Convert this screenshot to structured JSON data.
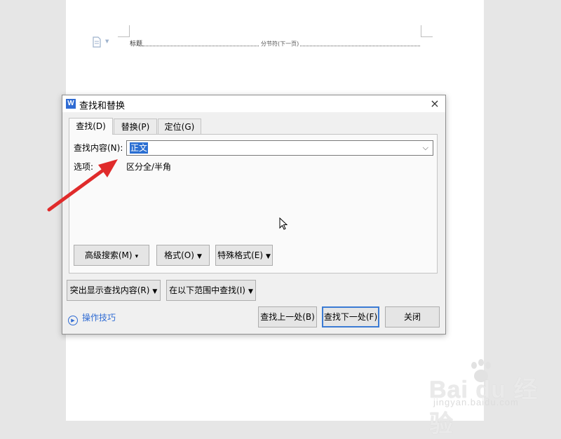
{
  "document": {
    "heading_text": "标题",
    "section_break_label": "分节符(下一页)"
  },
  "dialog": {
    "title": "查找和替换",
    "app_icon_letter": "W",
    "close_glyph": "×",
    "tabs": [
      {
        "label": "查找(D)",
        "active": true
      },
      {
        "label": "替换(P)",
        "active": false
      },
      {
        "label": "定位(G)",
        "active": false
      }
    ],
    "find": {
      "label": "查找内容(N):",
      "value": "正文",
      "dropdown_glyph": "⌵"
    },
    "options": {
      "label": "选项:",
      "value": "区分全/半角"
    },
    "buttons": {
      "advanced_search": "高级搜索(M)",
      "format": "格式(O)",
      "special_format": "特殊格式(E)",
      "highlight": "突出显示查找内容(R)",
      "find_in": "在以下范围中查找(I)",
      "find_prev": "查找上一处(B)",
      "find_next": "查找下一处(F)",
      "close": "关闭"
    },
    "tips_label": "操作技巧"
  },
  "watermark": {
    "brand": "Bai du 经验",
    "url": "jingyan.baidu.com"
  },
  "colors": {
    "accent": "#2f6bd3",
    "selection": "#2b6fd2",
    "annotation_arrow": "#e02b2b"
  }
}
